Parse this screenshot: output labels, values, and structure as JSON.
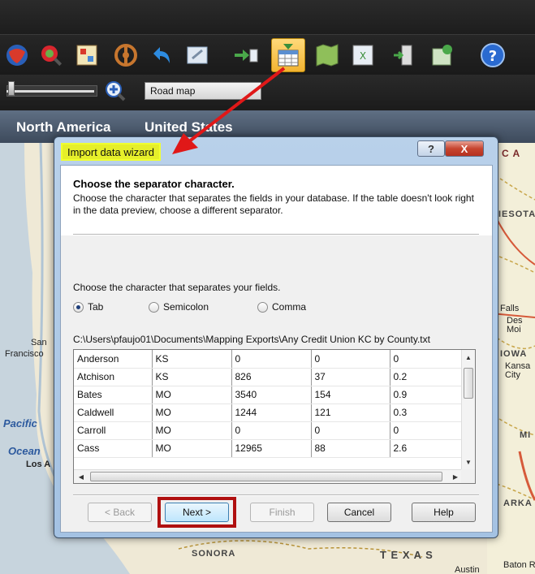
{
  "toolbar": {
    "icons": [
      {
        "name": "globe-icon",
        "color": "#d93a2b"
      },
      {
        "name": "find-location-icon",
        "color": "#d9262e"
      },
      {
        "name": "map-legend-icon",
        "color": "#4a8bd6"
      },
      {
        "name": "route-wheel-icon",
        "color": "#c7762e"
      },
      {
        "name": "undo-arrow-icon",
        "color": "#2d8be0"
      },
      {
        "name": "zoom-extent-icon",
        "color": "#8da9c7"
      },
      {
        "name": "export-arrow-icon",
        "color": "#4aa84a"
      },
      {
        "name": "import-data-icon",
        "color": "#3a8e3a"
      },
      {
        "name": "territory-map-icon",
        "color": "#6a9a4a"
      },
      {
        "name": "excel-icon",
        "color": "#3a8e3a"
      },
      {
        "name": "sign-out-icon",
        "color": "#aaaaaa"
      },
      {
        "name": "map-pin-icon",
        "color": "#4aa84a"
      },
      {
        "name": "help-icon",
        "color": "#2a6ad0"
      }
    ],
    "map_type_value": "Road map"
  },
  "breadcrumb": {
    "region": "North America",
    "country": "United States"
  },
  "map_labels": {
    "san_francisco": "San",
    "san_francisco_2": "Francisco",
    "pacific": "Pacific",
    "ocean": "Ocean",
    "los_angeles": "Los A",
    "sonora": "SONORA",
    "texas": "T E X A S",
    "austin": "Austin",
    "baton": "Baton R",
    "iowa": "IOWA",
    "kansas_city": "Kansa City",
    "minnesota": "IESOTA",
    "falls": "Falls",
    "des_moines": "Des Moi",
    "ark": "ARKA",
    "mi": "MI",
    "ca": "C A"
  },
  "dialog": {
    "title": "Import data wizard",
    "help_label": "?",
    "close_label": "X",
    "heading": "Choose the separator character.",
    "description": "Choose the character that separates the fields in your database. If the table doesn't look right in the data preview, choose a different separator.",
    "prompt": "Choose the character that separates your fields.",
    "separators": [
      {
        "label": "Tab",
        "selected": true
      },
      {
        "label": "Semicolon",
        "selected": false
      },
      {
        "label": "Comma",
        "selected": false
      }
    ],
    "file_path": "C:\\Users\\pfaujo01\\Documents\\Mapping Exports\\Any Credit Union KC by County.txt",
    "rows": [
      [
        "Anderson",
        "KS",
        "0",
        "0",
        "0"
      ],
      [
        "Atchison",
        "KS",
        "826",
        "37",
        "0.2"
      ],
      [
        "Bates",
        "MO",
        "3540",
        "154",
        "0.9"
      ],
      [
        "Caldwell",
        "MO",
        "1244",
        "121",
        "0.3"
      ],
      [
        "Carroll",
        "MO",
        "0",
        "0",
        "0"
      ],
      [
        "Cass",
        "MO",
        "12965",
        "88",
        "2.6"
      ]
    ],
    "buttons": {
      "back": "< Back",
      "next": "Next >",
      "finish": "Finish",
      "cancel": "Cancel",
      "help": "Help"
    }
  },
  "colors": {
    "title_highlight": "#e6ef2a",
    "annotation_red": "#b01010",
    "dialog_frame": "#b9d1ea"
  }
}
